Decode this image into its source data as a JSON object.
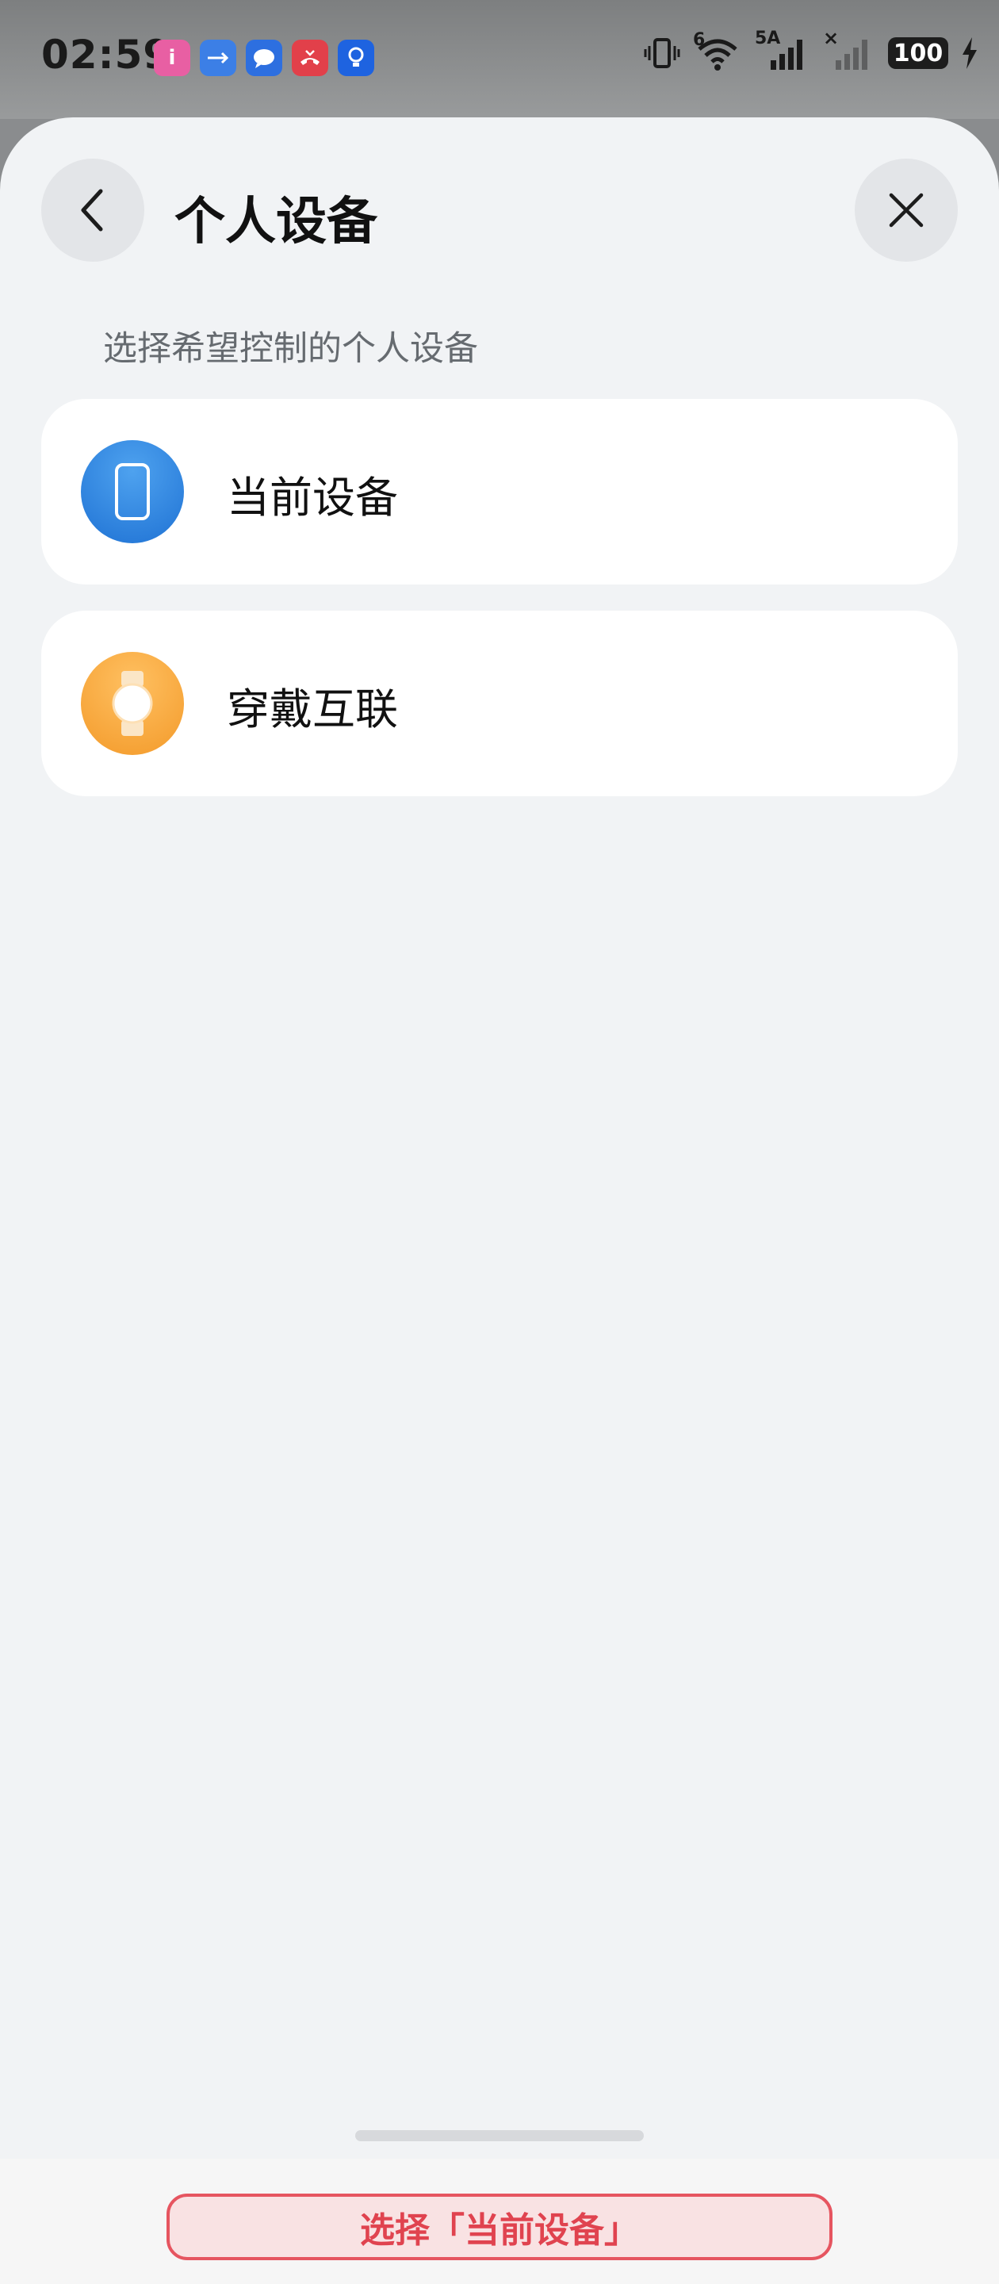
{
  "status_bar": {
    "time": "02:59",
    "notifications": [
      {
        "name": "app-i-icon",
        "glyph": "i",
        "color": "#e85fa3"
      },
      {
        "name": "usb-icon",
        "glyph": "⇆",
        "color": "#3c7fe6"
      },
      {
        "name": "message-icon",
        "glyph": "💬",
        "color": "#2d6fe0"
      },
      {
        "name": "missed-call-icon",
        "glyph": "✆",
        "color": "#e2404a"
      },
      {
        "name": "tips-icon",
        "glyph": "💡",
        "color": "#1e63e0"
      }
    ],
    "wifi_badge": "6",
    "network_label": "5A",
    "sim2_mark": "×",
    "battery": "100"
  },
  "header": {
    "title": "个人设备",
    "back_icon": "chevron-left-icon",
    "close_icon": "close-icon"
  },
  "subtitle": "选择希望控制的个人设备",
  "devices": [
    {
      "label": "当前设备",
      "icon": "phone-icon",
      "color": "#2f86e2"
    },
    {
      "label": "穿戴互联",
      "icon": "watch-icon",
      "color": "#f5a43a"
    }
  ],
  "action": {
    "label": "选择「当前设备」"
  }
}
